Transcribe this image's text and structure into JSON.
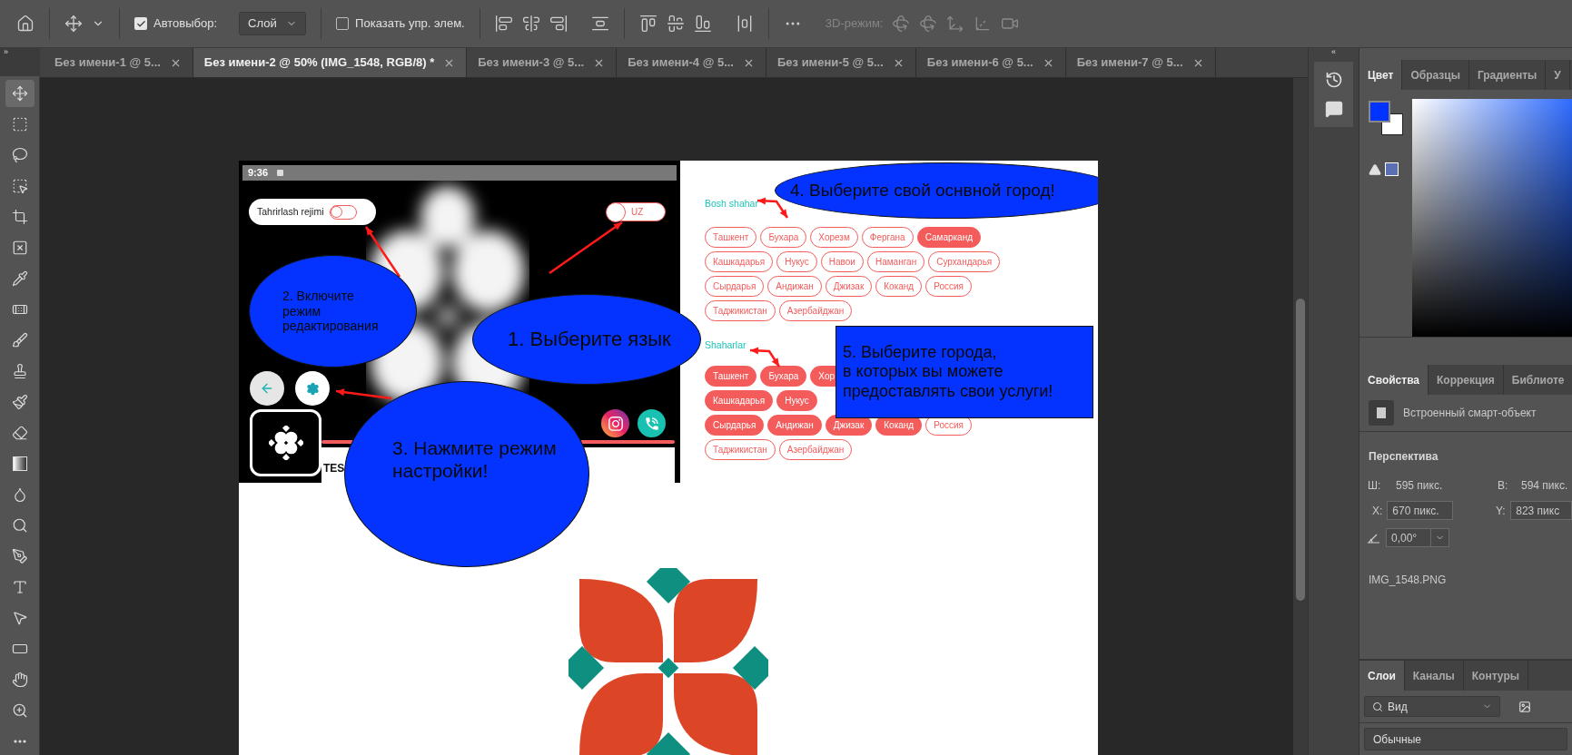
{
  "toolbar_expand": "»",
  "dock_collapse": "«",
  "options_bar": {
    "auto_select": {
      "label": "Автовыбор:",
      "checked": true
    },
    "auto_select_target": "Слой",
    "show_controls": {
      "label": "Показать упр. элем.",
      "checked": false
    },
    "mode_3d_label": "3D-режим:"
  },
  "tools": [
    {
      "kind": "move",
      "selected": true
    },
    {
      "kind": "marquee",
      "selected": false
    },
    {
      "kind": "lasso",
      "selected": false
    },
    {
      "kind": "object_select",
      "selected": false
    },
    {
      "kind": "crop",
      "selected": false
    },
    {
      "kind": "frame",
      "selected": false
    },
    {
      "kind": "eyedropper",
      "selected": false
    },
    {
      "kind": "healing",
      "selected": false
    },
    {
      "kind": "brush",
      "selected": false
    },
    {
      "kind": "stamp",
      "selected": false
    },
    {
      "kind": "history_brush",
      "selected": false
    },
    {
      "kind": "eraser",
      "selected": false
    },
    {
      "kind": "gradient",
      "selected": false
    },
    {
      "kind": "blur",
      "selected": false
    },
    {
      "kind": "dodge",
      "selected": false
    },
    {
      "kind": "pen",
      "selected": false
    },
    {
      "kind": "type",
      "selected": false
    },
    {
      "kind": "path_select",
      "selected": false
    },
    {
      "kind": "rectangle",
      "selected": false
    },
    {
      "kind": "hand",
      "selected": false
    },
    {
      "kind": "zoom",
      "selected": false
    },
    {
      "kind": "more",
      "selected": false
    }
  ],
  "tabs": [
    {
      "label": "Без имени-1 @ 5...",
      "selected": false
    },
    {
      "label": "Без имени-2 @ 50% (IMG_1548, RGB/8) *",
      "selected": true
    },
    {
      "label": "Без имени-3 @ 5...",
      "selected": false
    },
    {
      "label": "Без имени-4 @ 5...",
      "selected": false
    },
    {
      "label": "Без имени-5 @ 5...",
      "selected": false
    },
    {
      "label": "Без имени-6 @ 5...",
      "selected": false
    },
    {
      "label": "Без имени-7 @ 5...",
      "selected": false
    }
  ],
  "document": {
    "phone": {
      "time": "9:36",
      "edit_mode": {
        "label": "Tahrirlash rejimi",
        "on": false
      },
      "language": {
        "label": "UZ",
        "on": false
      },
      "caption": "TES"
    },
    "cities": {
      "main_heading": "Bosh shahar",
      "main": [
        {
          "name": "Ташкент",
          "selected": false
        },
        {
          "name": "Бухара",
          "selected": false
        },
        {
          "name": "Хорезм",
          "selected": false
        },
        {
          "name": "Фергана",
          "selected": false
        },
        {
          "name": "Самарканд",
          "selected": true
        },
        {
          "name": "Кашкадарья",
          "selected": false
        },
        {
          "name": "Нукус",
          "selected": false
        },
        {
          "name": "Навои",
          "selected": false
        },
        {
          "name": "Наманган",
          "selected": false
        },
        {
          "name": "Сурхандарья",
          "selected": false
        },
        {
          "name": "Сырдарья",
          "selected": false
        },
        {
          "name": "Андижан",
          "selected": false
        },
        {
          "name": "Джизак",
          "selected": false
        },
        {
          "name": "Коканд",
          "selected": false
        },
        {
          "name": "Россия",
          "selected": false
        },
        {
          "name": "Таджикистан",
          "selected": false
        },
        {
          "name": "Азербайджан",
          "selected": false
        }
      ],
      "others_heading": "Shaharlar",
      "others": [
        [
          {
            "name": "Ташкент",
            "selected": true
          },
          {
            "name": "Бухара",
            "selected": true
          },
          {
            "name": "Хор",
            "selected": true
          }
        ],
        [
          {
            "name": "Кашкадарья",
            "selected": true
          },
          {
            "name": "Нукус",
            "selected": true
          }
        ],
        [
          {
            "name": "Сырдарья",
            "selected": true
          },
          {
            "name": "Андижан",
            "selected": true
          },
          {
            "name": "Джизак",
            "selected": true
          },
          {
            "name": "Коканд",
            "selected": true
          },
          {
            "name": "Россия",
            "selected": false
          }
        ],
        [
          {
            "name": "Таджикистан",
            "selected": false
          },
          {
            "name": "Азербайджан",
            "selected": false
          }
        ]
      ]
    },
    "callouts": [
      {
        "kind": "ellipse",
        "text": "4. Выберите свой оснвной город!"
      },
      {
        "kind": "ellipse",
        "text": "2. Включите\n режим\nредактирования"
      },
      {
        "kind": "ellipse",
        "text": "1. Выберите язык"
      },
      {
        "kind": "box",
        "text": "5. Выберите города,\nв которых вы можете\nпредоставлять свои услуги!"
      },
      {
        "kind": "ellipse",
        "text": "3. Нажмите режим\nнастройки!"
      }
    ]
  },
  "color_panel": {
    "tabs": [
      {
        "label": "Цвет",
        "selected": true
      },
      {
        "label": "Образцы",
        "selected": false
      },
      {
        "label": "Градиенты",
        "selected": false
      },
      {
        "label": "У",
        "selected": false
      }
    ]
  },
  "properties_panel": {
    "tabs": [
      {
        "label": "Свойства",
        "selected": true
      },
      {
        "label": "Коррекция",
        "selected": false
      },
      {
        "label": "Библиоте",
        "selected": false
      }
    ],
    "object_type": "Встроенный смарт-объект",
    "section": "Перспектива",
    "width": {
      "label": "Ш:",
      "value": "595 пикс."
    },
    "height": {
      "label": "В:",
      "value": "594 пикс."
    },
    "x": {
      "label": "X:",
      "value": "670 пикс."
    },
    "y": {
      "label": "Y:",
      "value": "823 пикс"
    },
    "angle": "0,00°",
    "file_name": "IMG_1548.PNG"
  },
  "layers_panel": {
    "tabs": [
      {
        "label": "Слои",
        "selected": true
      },
      {
        "label": "Каналы",
        "selected": false
      },
      {
        "label": "Контуры",
        "selected": false
      }
    ],
    "filter": "Вид",
    "blend_mode": "Обычные"
  }
}
